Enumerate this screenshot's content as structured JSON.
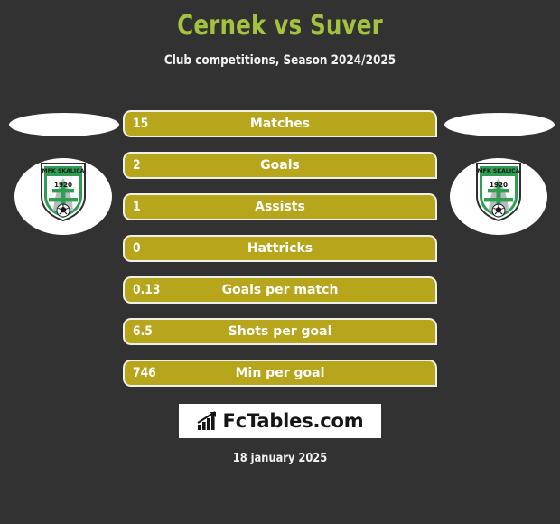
{
  "header": {
    "title": "Cernek vs Suver",
    "subtitle": "Club competitions, Season 2024/2025",
    "title_color": "#a3c23f",
    "subtitle_color": "#f2f2f2"
  },
  "theme": {
    "background": "#323232",
    "bar_fill": "#b7a51c",
    "bar_border": "#f0f0ea",
    "text_on_bar": "#ffffff"
  },
  "teams": {
    "left": {
      "name": "",
      "crest": {
        "icon": "mfk-skalica-crest-icon",
        "club_name": "MFK SKALICA",
        "founded": "1920"
      }
    },
    "right": {
      "name": "",
      "crest": {
        "icon": "mfk-skalica-crest-icon",
        "club_name": "MFK SKALICA",
        "founded": "1920"
      }
    }
  },
  "stats": [
    {
      "value": "15",
      "label": "Matches"
    },
    {
      "value": "2",
      "label": "Goals"
    },
    {
      "value": "1",
      "label": "Assists"
    },
    {
      "value": "0",
      "label": "Hattricks"
    },
    {
      "value": "0.13",
      "label": "Goals per match"
    },
    {
      "value": "6.5",
      "label": "Shots per goal"
    },
    {
      "value": "746",
      "label": "Min per goal"
    }
  ],
  "footer": {
    "brand_text": "FcTables.com",
    "brand_icon": "bar-chart-growth-icon",
    "date": "18 january 2025"
  }
}
